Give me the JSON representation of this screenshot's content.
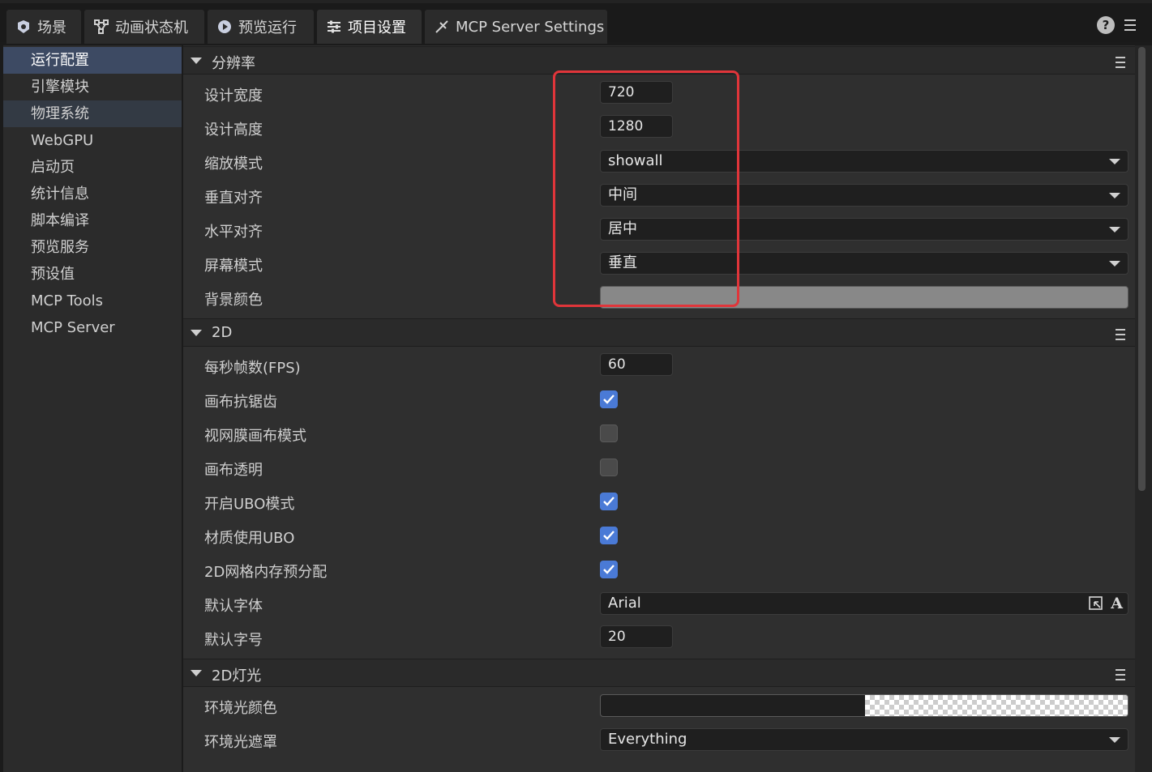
{
  "tabs": [
    {
      "label": "场景",
      "icon": "scene-icon"
    },
    {
      "label": "动画状态机",
      "icon": "state-machine-icon"
    },
    {
      "label": "预览运行",
      "icon": "preview-icon"
    },
    {
      "label": "项目设置",
      "icon": "settings-sliders-icon"
    },
    {
      "label": "MCP Server Settings",
      "icon": "plugin-icon"
    }
  ],
  "header_right": {
    "help": "?"
  },
  "sidebar": {
    "items": [
      {
        "label": "运行配置"
      },
      {
        "label": "引擎模块"
      },
      {
        "label": "物理系统"
      },
      {
        "label": "WebGPU"
      },
      {
        "label": "启动页"
      },
      {
        "label": "统计信息"
      },
      {
        "label": "脚本编译"
      },
      {
        "label": "预览服务"
      },
      {
        "label": "预设值"
      },
      {
        "label": "MCP Tools"
      },
      {
        "label": "MCP Server"
      }
    ]
  },
  "resolution": {
    "title": "分辨率",
    "design_width_label": "设计宽度",
    "design_width": "720",
    "design_height_label": "设计高度",
    "design_height": "1280",
    "scale_mode_label": "缩放模式",
    "scale_mode": "showall",
    "valign_label": "垂直对齐",
    "valign": "中间",
    "halign_label": "水平对齐",
    "halign": "居中",
    "screen_mode_label": "屏幕模式",
    "screen_mode": "垂直",
    "bg_color_label": "背景颜色",
    "bg_color": "#888888"
  },
  "two_d": {
    "title": "2D",
    "fps_label": "每秒帧数(FPS)",
    "fps": "60",
    "antialias_label": "画布抗锯齿",
    "antialias": true,
    "retina_label": "视网膜画布模式",
    "retina": false,
    "transparent_label": "画布透明",
    "transparent": false,
    "ubo_label": "开启UBO模式",
    "ubo": true,
    "material_ubo_label": "材质使用UBO",
    "material_ubo": true,
    "mesh_prealloc_label": "2D网格内存预分配",
    "mesh_prealloc": true,
    "default_font_label": "默认字体",
    "default_font": "Arial",
    "default_font_size_label": "默认字号",
    "default_font_size": "20"
  },
  "light_2d": {
    "title": "2D灯光",
    "ambient_color_label": "环境光颜色",
    "ambient_mask_label": "环境光遮罩",
    "ambient_mask": "Everything"
  },
  "colors": {
    "accent": "#4a7ad6",
    "highlight": "#e0353a",
    "selected_item": "#3d4a63"
  }
}
